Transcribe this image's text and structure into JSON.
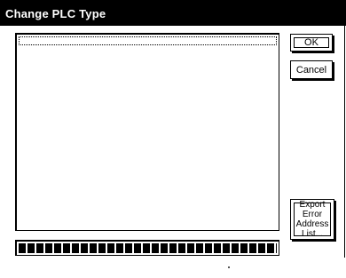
{
  "dialog": {
    "title": "Change PLC Type"
  },
  "buttons": {
    "ok_label": "OK",
    "cancel_label": "Cancel",
    "export_lines": [
      "Export",
      "Error",
      "Address",
      "List..."
    ]
  },
  "progress": {
    "fraction": 1.0
  },
  "colors": {
    "title_bar": "#000000",
    "background": "#ffffff"
  }
}
